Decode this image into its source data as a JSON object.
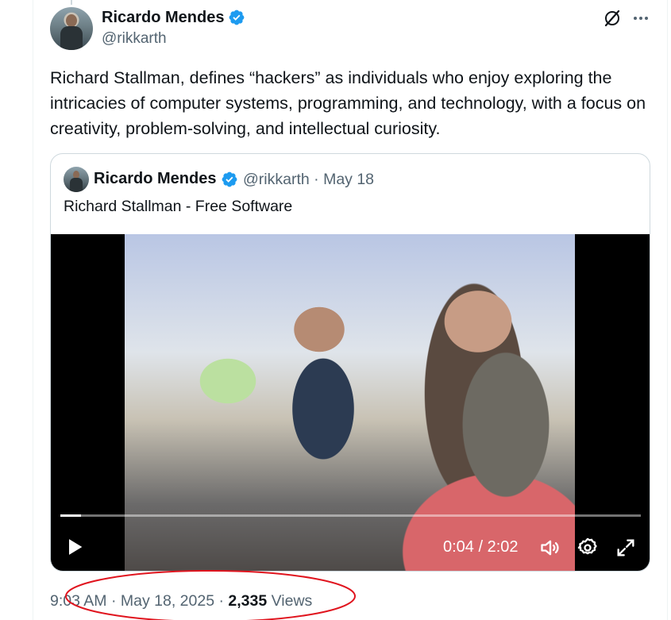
{
  "tweet": {
    "author": {
      "name": "Ricardo Mendes",
      "handle": "@rikkarth",
      "verified_color": "#1d9bf0"
    },
    "text": "Richard Stallman, defines “hackers” as individuals who enjoy exploring the intricacies of computer systems, programming, and technology, with a focus on creativity, problem-solving, and intellectual curiosity.",
    "icons": {
      "grok": "grok-icon",
      "more": "more-icon"
    },
    "quote": {
      "author": {
        "name": "Ricardo Mendes",
        "handle": "@rikkarth",
        "date": "May 18",
        "separator": "·"
      },
      "text": "Richard Stallman - Free Software",
      "video": {
        "time": "0:04 / 2:02",
        "progress": 0.035,
        "controls": [
          "play-icon",
          "volume-icon",
          "settings-icon",
          "fullscreen-icon"
        ]
      }
    },
    "meta": {
      "time": "9:03 AM",
      "separator": "·",
      "date": "May 18, 2025",
      "views_count": "2,335",
      "views_label": "Views"
    },
    "annotation_color": "#e0141e"
  }
}
